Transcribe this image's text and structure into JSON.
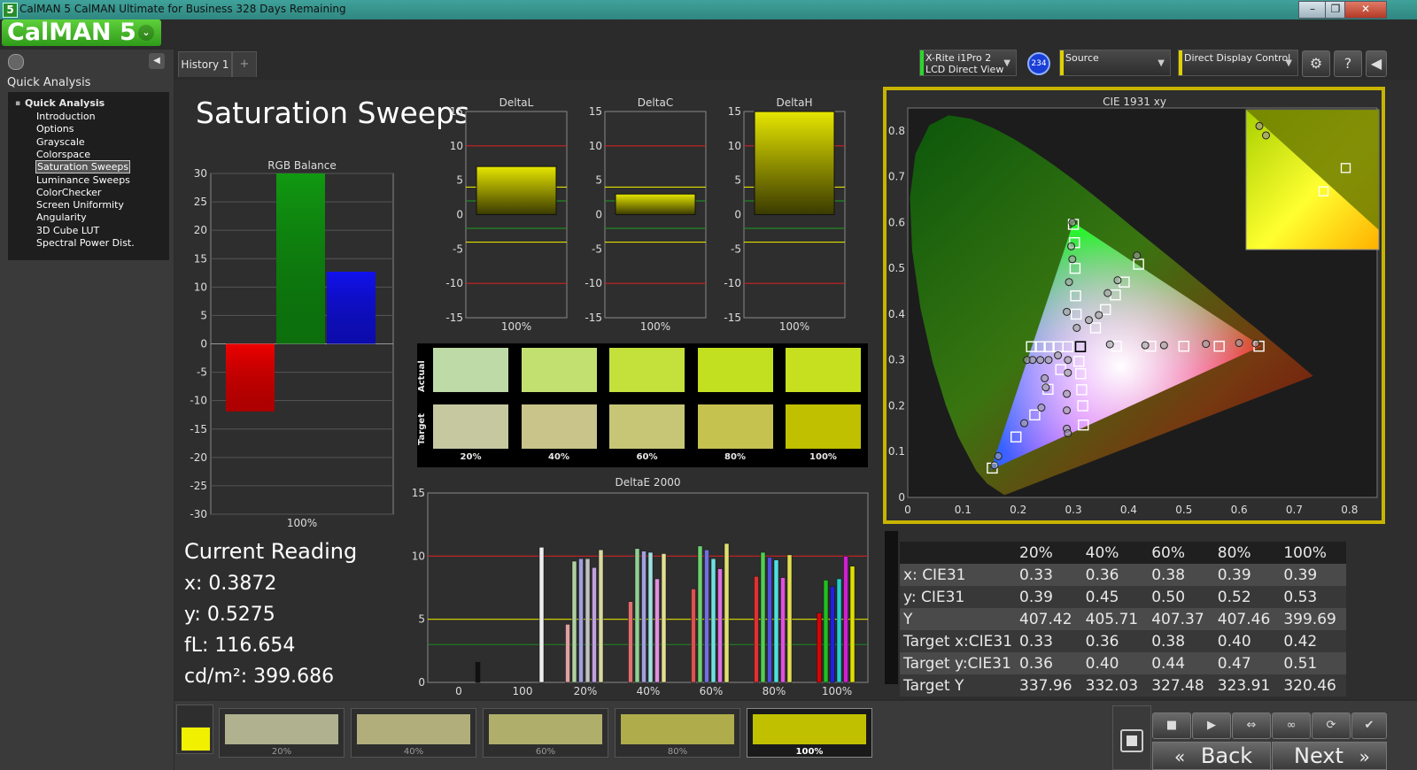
{
  "window": {
    "icon_label": "5",
    "title": "CalMAN 5 CalMAN Ultimate for Business 328 Days Remaining",
    "btn_min": "–",
    "btn_max": "❐",
    "btn_close": "✕"
  },
  "brand": {
    "name": "CalMAN 5",
    "dropdown": "⌄"
  },
  "sidebar": {
    "heading": "Quick Analysis",
    "collapse_icon": "◀",
    "tree_root": "Quick Analysis",
    "items": [
      "Introduction",
      "Options",
      "Grayscale",
      "Colorspace",
      "Saturation Sweeps",
      "Luminance Sweeps",
      "ColorChecker",
      "Screen Uniformity",
      "Angularity",
      "3D Cube LUT",
      "Spectral Power Dist."
    ],
    "selected_index": 4
  },
  "tabs": {
    "history": "History 1",
    "add": "+"
  },
  "devices": {
    "meter_line1": "X-Rite i1Pro 2",
    "meter_line2": "LCD Direct View",
    "meter_badge": "234",
    "source": "Source",
    "display": "Direct Display Control"
  },
  "page_title": "Saturation Sweeps",
  "rgb_balance": {
    "title": "RGB Balance",
    "ylim": [
      -30,
      30
    ],
    "ticks": [
      30,
      25,
      20,
      15,
      10,
      5,
      0,
      -5,
      -10,
      -15,
      -20,
      -25,
      -30
    ],
    "x_label": "100%",
    "values": [
      {
        "name": "R",
        "value": -11.9,
        "color": "#ee0000"
      },
      {
        "name": "G",
        "value": 30,
        "color": "#119911"
      },
      {
        "name": "B",
        "value": 12.7,
        "color": "#1111ee"
      }
    ]
  },
  "delta_charts": [
    {
      "title": "DeltaL",
      "low": 0,
      "high": 7,
      "x_label": "100%"
    },
    {
      "title": "DeltaC",
      "low": 0,
      "high": 3,
      "x_label": "100%"
    },
    {
      "title": "DeltaH",
      "low": 0,
      "high": 15,
      "x_label": "100%"
    }
  ],
  "delta_ticks": [
    15,
    10,
    5,
    0,
    -5,
    -10,
    -15
  ],
  "swatches": {
    "actual_label": "Actual",
    "target_label": "Target",
    "labels": [
      "20%",
      "40%",
      "60%",
      "80%",
      "100%"
    ],
    "actual_colors": [
      "#bedaa6",
      "#c2e070",
      "#c4e03a",
      "#c2e020",
      "#c6e020"
    ],
    "target_colors": [
      "#c6c8a0",
      "#c8c48a",
      "#c6c676",
      "#c6c250",
      "#c0c000"
    ]
  },
  "deltae": {
    "title": "DeltaE 2000",
    "ylim": [
      0,
      15
    ],
    "ticks": [
      15,
      10,
      5,
      0
    ],
    "categories": [
      "0",
      "100",
      "20%",
      "40%",
      "60%",
      "80%",
      "100%"
    ],
    "groups": [
      {
        "label": "0",
        "values": [
          1.6
        ],
        "colors": [
          "#111111"
        ]
      },
      {
        "label": "100",
        "values": [
          10.7
        ],
        "colors": [
          "#eeeeee"
        ]
      },
      {
        "label": "20%",
        "values": [
          4.6,
          9.6,
          9.8,
          9.8,
          9.1,
          10.5
        ],
        "colors": [
          "#e0a0a0",
          "#b0d0a0",
          "#a0a0e0",
          "#c0c0c0",
          "#c0a0e0",
          "#d8d8a0"
        ]
      },
      {
        "label": "40%",
        "values": [
          6.4,
          10.6,
          10.4,
          10.3,
          8.2,
          10.2
        ],
        "colors": [
          "#e07070",
          "#90d090",
          "#a0a0e0",
          "#a0e0e0",
          "#e090e0",
          "#e0e090"
        ]
      },
      {
        "label": "60%",
        "values": [
          7.4,
          10.8,
          10.5,
          9.8,
          9.0,
          11.0
        ],
        "colors": [
          "#e05050",
          "#70d070",
          "#7070e0",
          "#70e0e0",
          "#e070e0",
          "#e0e070"
        ]
      },
      {
        "label": "80%",
        "values": [
          8.4,
          10.3,
          9.9,
          9.7,
          8.3,
          10.1
        ],
        "colors": [
          "#e03030",
          "#50d050",
          "#5050e0",
          "#50e0e0",
          "#e050e0",
          "#e0e050"
        ]
      },
      {
        "label": "100%",
        "values": [
          5.5,
          8.1,
          7.6,
          8.2,
          10.0,
          9.2
        ],
        "colors": [
          "#e00000",
          "#20c020",
          "#2020e0",
          "#20d0d0",
          "#d020d0",
          "#e0e000"
        ]
      }
    ]
  },
  "readings": {
    "heading": "Current Reading",
    "x": "x: 0.3872",
    "y": "y: 0.5275",
    "fl": "fL: 116.654",
    "cd": "cd/m²: 399.686"
  },
  "cie": {
    "title": "CIE 1931 xy",
    "x_ticks": [
      "0",
      "0.1",
      "0.2",
      "0.3",
      "0.4",
      "0.5",
      "0.6",
      "0.7",
      "0.8"
    ],
    "y_ticks": [
      "0.8",
      "0.7",
      "0.6",
      "0.5",
      "0.4",
      "0.3",
      "0.2",
      "0.1",
      "0"
    ],
    "gamut": {
      "r": [
        0.64,
        0.33
      ],
      "g": [
        0.3,
        0.6
      ],
      "b": [
        0.15,
        0.06
      ]
    },
    "white": [
      0.3127,
      0.329
    ],
    "targets": [
      [
        0.224,
        0.329
      ],
      [
        0.24,
        0.329
      ],
      [
        0.256,
        0.329
      ],
      [
        0.272,
        0.329
      ],
      [
        0.29,
        0.329
      ],
      [
        0.378,
        0.33
      ],
      [
        0.44,
        0.33
      ],
      [
        0.5,
        0.33
      ],
      [
        0.564,
        0.33
      ],
      [
        0.636,
        0.33
      ],
      [
        0.3,
        0.596
      ],
      [
        0.302,
        0.556
      ],
      [
        0.303,
        0.5
      ],
      [
        0.304,
        0.44
      ],
      [
        0.305,
        0.4
      ],
      [
        0.418,
        0.509
      ],
      [
        0.392,
        0.47
      ],
      [
        0.376,
        0.442
      ],
      [
        0.358,
        0.41
      ],
      [
        0.34,
        0.37
      ],
      [
        0.277,
        0.279
      ],
      [
        0.254,
        0.236
      ],
      [
        0.23,
        0.18
      ],
      [
        0.196,
        0.132
      ],
      [
        0.153,
        0.064
      ],
      [
        0.31,
        0.297
      ],
      [
        0.313,
        0.27
      ],
      [
        0.315,
        0.235
      ],
      [
        0.317,
        0.2
      ],
      [
        0.318,
        0.158
      ]
    ],
    "actuals": [
      [
        0.216,
        0.3
      ],
      [
        0.226,
        0.3
      ],
      [
        0.24,
        0.3
      ],
      [
        0.255,
        0.3
      ],
      [
        0.272,
        0.31
      ],
      [
        0.29,
        0.3
      ],
      [
        0.366,
        0.334
      ],
      [
        0.43,
        0.332
      ],
      [
        0.464,
        0.332
      ],
      [
        0.54,
        0.335
      ],
      [
        0.6,
        0.337
      ],
      [
        0.63,
        0.336
      ],
      [
        0.298,
        0.6
      ],
      [
        0.296,
        0.548
      ],
      [
        0.298,
        0.52
      ],
      [
        0.292,
        0.47
      ],
      [
        0.288,
        0.405
      ],
      [
        0.415,
        0.528
      ],
      [
        0.38,
        0.474
      ],
      [
        0.362,
        0.446
      ],
      [
        0.346,
        0.398
      ],
      [
        0.328,
        0.387
      ],
      [
        0.306,
        0.37
      ],
      [
        0.25,
        0.24
      ],
      [
        0.242,
        0.196
      ],
      [
        0.211,
        0.162
      ],
      [
        0.164,
        0.09
      ],
      [
        0.157,
        0.07
      ],
      [
        0.29,
        0.272
      ],
      [
        0.288,
        0.226
      ],
      [
        0.288,
        0.19
      ],
      [
        0.288,
        0.15
      ],
      [
        0.29,
        0.14
      ],
      [
        0.248,
        0.26
      ]
    ],
    "inset_targets": [
      [
        0.485,
        0.515
      ],
      [
        0.475,
        0.505
      ]
    ],
    "inset_actuals": [
      [
        0.446,
        0.533
      ],
      [
        0.449,
        0.529
      ]
    ]
  },
  "table": {
    "headers": [
      "",
      "20%",
      "40%",
      "60%",
      "80%",
      "100%"
    ],
    "rows": [
      [
        "x: CIE31",
        "0.33",
        "0.36",
        "0.38",
        "0.39",
        "0.39"
      ],
      [
        "y: CIE31",
        "0.39",
        "0.45",
        "0.50",
        "0.52",
        "0.53"
      ],
      [
        "Y",
        "407.42",
        "405.71",
        "407.37",
        "407.46",
        "399.69"
      ],
      [
        "Target x:CIE31",
        "0.33",
        "0.36",
        "0.38",
        "0.40",
        "0.42"
      ],
      [
        "Target y:CIE31",
        "0.36",
        "0.40",
        "0.44",
        "0.47",
        "0.51"
      ],
      [
        "Target Y",
        "337.96",
        "332.03",
        "327.48",
        "323.91",
        "320.46"
      ]
    ]
  },
  "patches": [
    {
      "label": "20%",
      "color": "#c6c8a0"
    },
    {
      "label": "40%",
      "color": "#c8c48a"
    },
    {
      "label": "60%",
      "color": "#c6c676"
    },
    {
      "label": "80%",
      "color": "#c6c250"
    },
    {
      "label": "100%",
      "color": "#c0c000"
    }
  ],
  "nav": {
    "back": "Back",
    "next": "Next",
    "back_icon": "«",
    "next_icon": "»"
  }
}
